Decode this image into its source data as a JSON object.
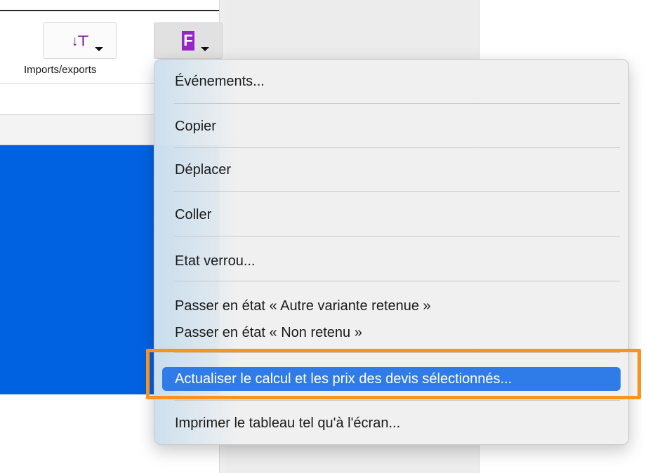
{
  "toolbar": {
    "imports_exports_label": "Imports/exports",
    "imports_icon_glyph": "↓⊤",
    "f_button_glyph": "F"
  },
  "context_menu": {
    "items": [
      {
        "label": "Événements..."
      },
      {
        "label": "Copier"
      },
      {
        "label": "Déplacer"
      },
      {
        "label": "Coller"
      },
      {
        "label": "Etat verrou..."
      },
      {
        "label": "Passer en état « Autre variante retenue »"
      },
      {
        "label": "Passer en état « Non retenu »"
      },
      {
        "label": "Actualiser le calcul et les prix des devis sélectionnés...",
        "highlighted": true
      },
      {
        "label": "Imprimer le tableau tel qu'à l'écran..."
      }
    ]
  },
  "colors": {
    "selection_blue": "#0062e1",
    "menu_highlight": "#2f7ce8",
    "annotation_orange": "#f7931e",
    "icon_purple": "#9626c9"
  }
}
